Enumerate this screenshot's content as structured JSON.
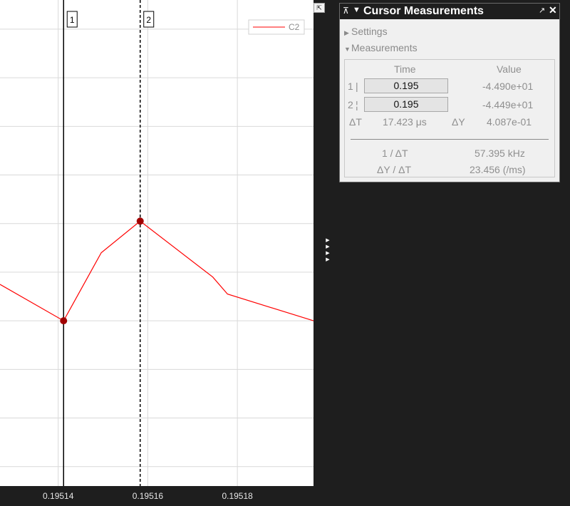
{
  "chart_data": {
    "type": "line",
    "title": "",
    "xlabel": "",
    "ylabel": "",
    "xlim": [
      0.195127,
      0.195197
    ],
    "ylim": [
      -45.58,
      -43.58
    ],
    "x_ticks": [
      "0.19514",
      "0.19516",
      "0.19518"
    ],
    "x_tick_values": [
      0.19514,
      0.19516,
      0.19518
    ],
    "y_gridlines": [
      -45.5,
      -45.3,
      -45.1,
      -44.9,
      -44.7,
      -44.5,
      -44.3,
      -44.1,
      -43.9,
      -43.7
    ],
    "x_gridlines": [
      0.19514,
      0.19516,
      0.19518
    ],
    "grid": true,
    "legend": {
      "position": "top-right",
      "entries": [
        "C2"
      ]
    },
    "series": [
      {
        "name": "C2",
        "color": "#ff0000",
        "x": [
          0.195127,
          0.1951412,
          0.1951496,
          0.1951583,
          0.1951745,
          0.1951778,
          0.195197
        ],
        "y": [
          -44.75,
          -44.9,
          -44.62,
          -44.49,
          -44.72,
          -44.79,
          -44.9
        ]
      }
    ],
    "cursors": [
      {
        "label": "1",
        "x": 0.1951412,
        "y": -44.9,
        "style": "solid"
      },
      {
        "label": "2",
        "x": 0.1951583,
        "y": -44.49,
        "style": "dashed"
      }
    ]
  },
  "panel": {
    "title": "Cursor Measurements",
    "settings_label": "Settings",
    "measurements_label": "Measurements",
    "col_time": "Time",
    "col_value": "Value",
    "rows": [
      {
        "label": "1",
        "time": "0.195",
        "value": "-4.490e+01"
      },
      {
        "label": "2",
        "time": "0.195",
        "value": "-4.449e+01"
      }
    ],
    "delta_t_label": "ΔT",
    "delta_t_value": "17.423 μs",
    "delta_y_label": "ΔY",
    "delta_y_value": "4.087e-01",
    "inv_dt_label": "1 / ΔT",
    "inv_dt_value": "57.395 kHz",
    "slope_label": "ΔY / ΔT",
    "slope_value": "23.456 (/ms)"
  },
  "colors": {
    "background": "#1e1e1e",
    "plot_bg": "#ffffff",
    "grid": "#d9d9d9",
    "series": "#ff0000",
    "marker": "#a00000"
  },
  "icons": {
    "pin": "pin-icon",
    "collapse": "triangle-down-icon",
    "undock": "undock-icon",
    "close": "close-icon",
    "dock": "dock-icon"
  }
}
